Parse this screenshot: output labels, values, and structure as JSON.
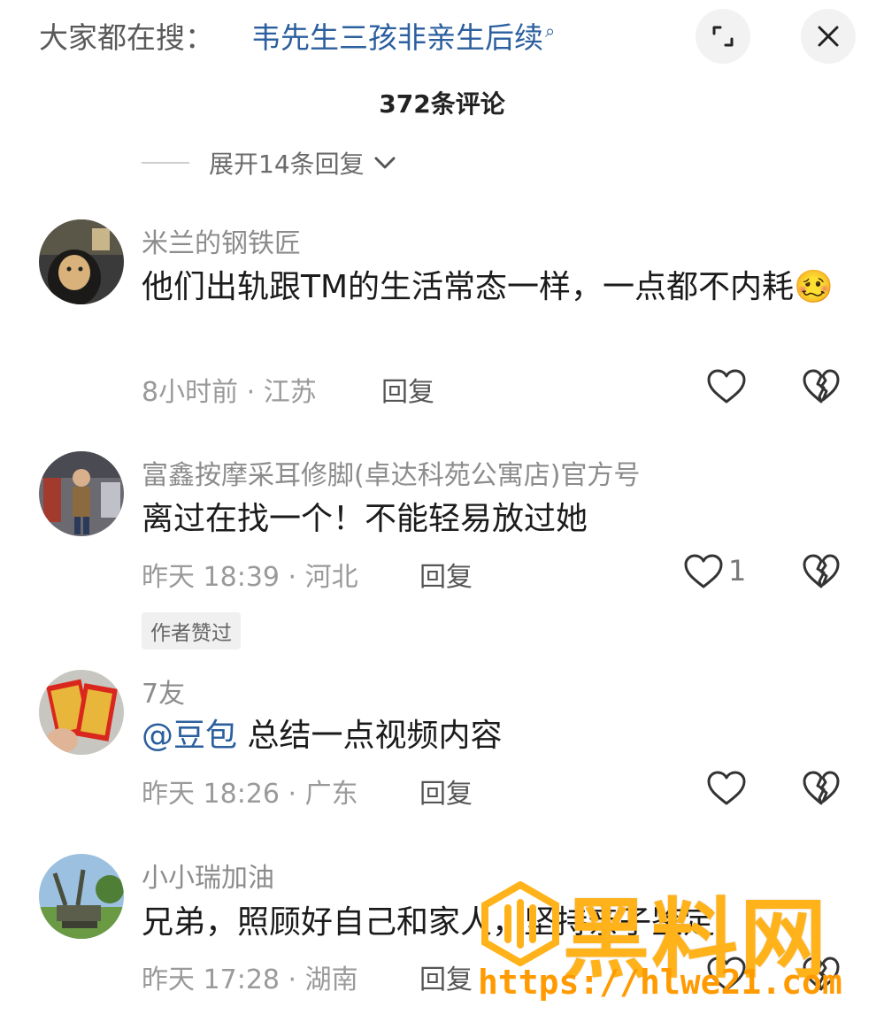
{
  "search": {
    "prefix": "大家都在搜：",
    "term": "韦先生三孩非亲生后续",
    "term_icon": "search-icon"
  },
  "header": {
    "comment_count": "372条评论",
    "expand_icon": "expand-icon",
    "close_icon": "close-icon"
  },
  "expand_replies": {
    "label": "展开14条回复",
    "icon": "chevron-down-icon"
  },
  "comments": [
    {
      "username": "米兰的钢铁匠",
      "content": "他们出轨跟TM的生活常态一样，一点都不内耗",
      "emoji": "🥴",
      "time": "8小时前",
      "location": "江苏",
      "reply": "回复",
      "likes": ""
    },
    {
      "username": "富鑫按摩采耳修脚(卓达科苑公寓店)官方号",
      "content": "离过在找一个！不能轻易放过她",
      "time": "昨天 18:39",
      "location": "河北",
      "reply": "回复",
      "likes": "1",
      "badge": "作者赞过"
    },
    {
      "username": "7友",
      "mention": "@豆包",
      "content": "总结一点视频内容",
      "time": "昨天 18:26",
      "location": "广东",
      "reply": "回复",
      "likes": ""
    },
    {
      "username": "小小瑞加油",
      "content": "兄弟，照顾好自己和家人，坚持亲子鉴定！",
      "time": "昨天 17:28",
      "location": "湖南",
      "reply": "回复",
      "likes": ""
    }
  ],
  "watermark": {
    "brand": "黑料网",
    "url": "https://hlwe21.com"
  },
  "colors": {
    "link": "#2b5f9e",
    "muted": "#9a9a9a",
    "watermark": "#ffb21a"
  }
}
